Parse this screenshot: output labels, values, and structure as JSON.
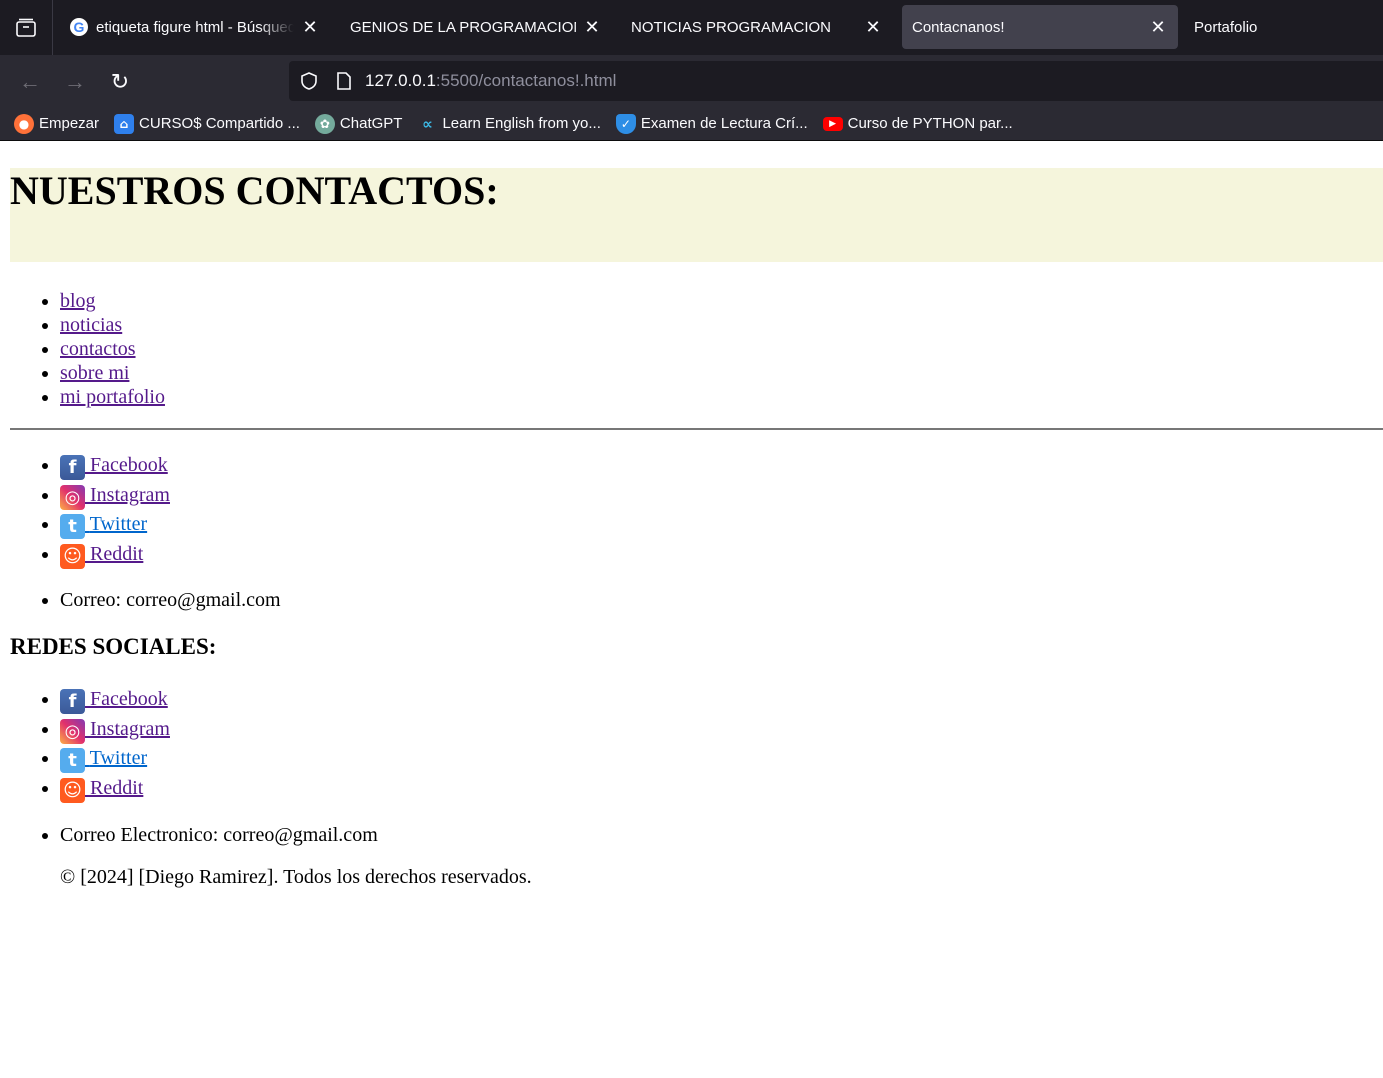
{
  "browser": {
    "tabs": [
      {
        "title": "etiqueta figure html - Búsqueda",
        "active": false,
        "icon": "google-icon"
      },
      {
        "title": "GENIOS DE LA PROGRAMACION",
        "active": false
      },
      {
        "title": "NOTICIAS PROGRAMACION",
        "active": false
      },
      {
        "title": "Contacnanos!",
        "active": true
      },
      {
        "title": "Portafolio",
        "active": false
      }
    ],
    "url_host": "127.0.0.1",
    "url_path": ":5500/contactanos!.html",
    "bookmarks": [
      {
        "label": "Empezar",
        "icon": "firefox-icon",
        "color": "#ff7139"
      },
      {
        "label": "CURSO$ Compartido ...",
        "icon": "drive-icon",
        "color": "#2f80ed"
      },
      {
        "label": "ChatGPT",
        "icon": "chatgpt-icon",
        "color": "#74aa9c"
      },
      {
        "label": "Learn English from yo...",
        "icon": "learn-english-icon",
        "color": "#3cb9e6"
      },
      {
        "label": "Examen de Lectura Crí...",
        "icon": "shield-check-icon",
        "color": "#2e8ee6"
      },
      {
        "label": "Curso de PYTHON par...",
        "icon": "youtube-icon",
        "color": "#ff0000"
      }
    ]
  },
  "page": {
    "heading": "NUESTROS CONTACTOS:",
    "nav": [
      "blog",
      "noticias",
      "contactos",
      "sobre mi",
      "mi portafolio"
    ],
    "social_1": [
      "Facebook",
      "Instagram",
      "Twitter",
      "Reddit"
    ],
    "email_1": "Correo: correo@gmail.com",
    "section_title": "REDES SOCIALES:",
    "social_2": [
      "Facebook",
      "Instagram",
      "Twitter",
      "Reddit"
    ],
    "email_2": "Correo Electronico: correo@gmail.com",
    "footer": "© [2024] [Diego Ramirez]. Todos los derechos reservados."
  }
}
